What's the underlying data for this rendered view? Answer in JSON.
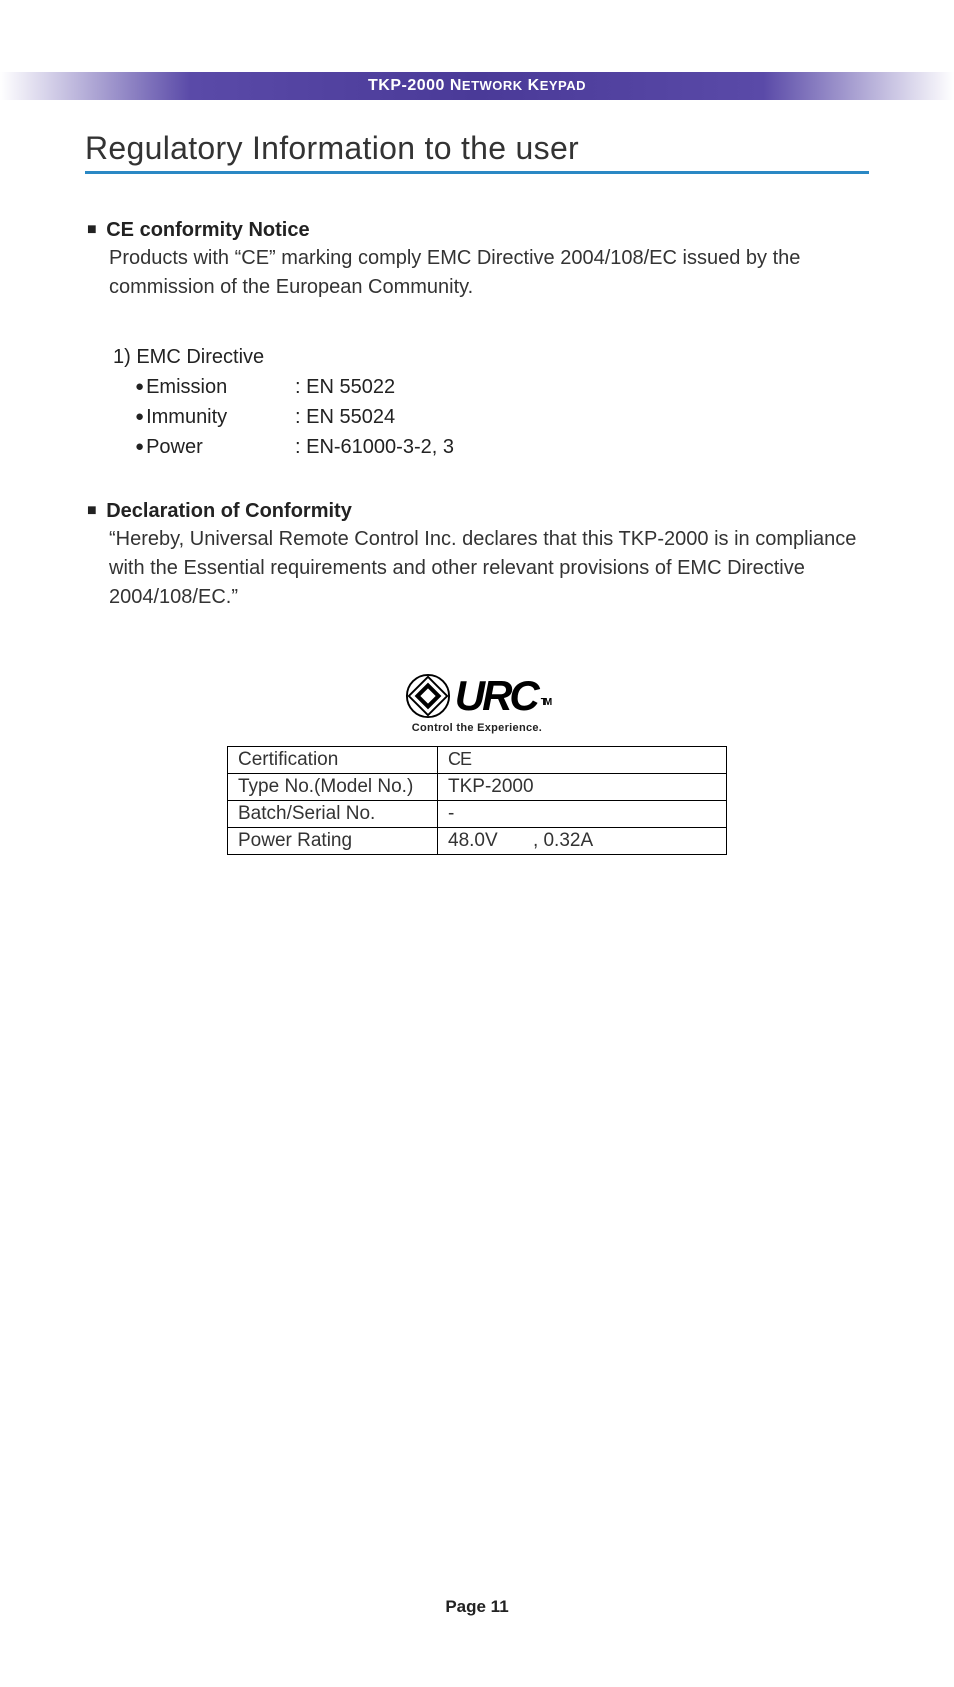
{
  "header": {
    "title_prefix": "TKP-2000 N",
    "title_mid": "ETWORK",
    "title_k": " K",
    "title_end": "EYPAD"
  },
  "page_title": "Regulatory Information to the user",
  "ce_section": {
    "heading": "CE conformity Notice",
    "body": "Products with “CE” marking comply EMC Directive 2004/108/EC issued by the commission of the European Community."
  },
  "emc": {
    "title": "1) EMC Directive",
    "items": [
      {
        "label": "Emission",
        "value": ": EN 55022"
      },
      {
        "label": "Immunity",
        "value": ": EN 55024"
      },
      {
        "label": "Power",
        "value": ": EN-61000-3-2, 3"
      }
    ]
  },
  "declaration": {
    "heading": "Declaration of Conformity",
    "body": "“Hereby, Universal Remote Control Inc. declares that this TKP-2000 is in compliance with the Essential requirements and other relevant provisions of EMC Directive 2004/108/EC.”"
  },
  "logo": {
    "brand": "URC",
    "tm": "TM",
    "tagline": "Control the Experience."
  },
  "table": {
    "rows": [
      {
        "label": "Certification",
        "value": "CE",
        "is_ce": true
      },
      {
        "label": "Type No.(Model No.)",
        "value": "TKP-2000"
      },
      {
        "label": "Batch/Serial No.",
        "value": "-"
      },
      {
        "label": "Power Rating",
        "value_pre": "48.0V",
        "value_post": ", 0.32A",
        "has_dc": true
      }
    ]
  },
  "footer": {
    "page": "Page 11"
  }
}
